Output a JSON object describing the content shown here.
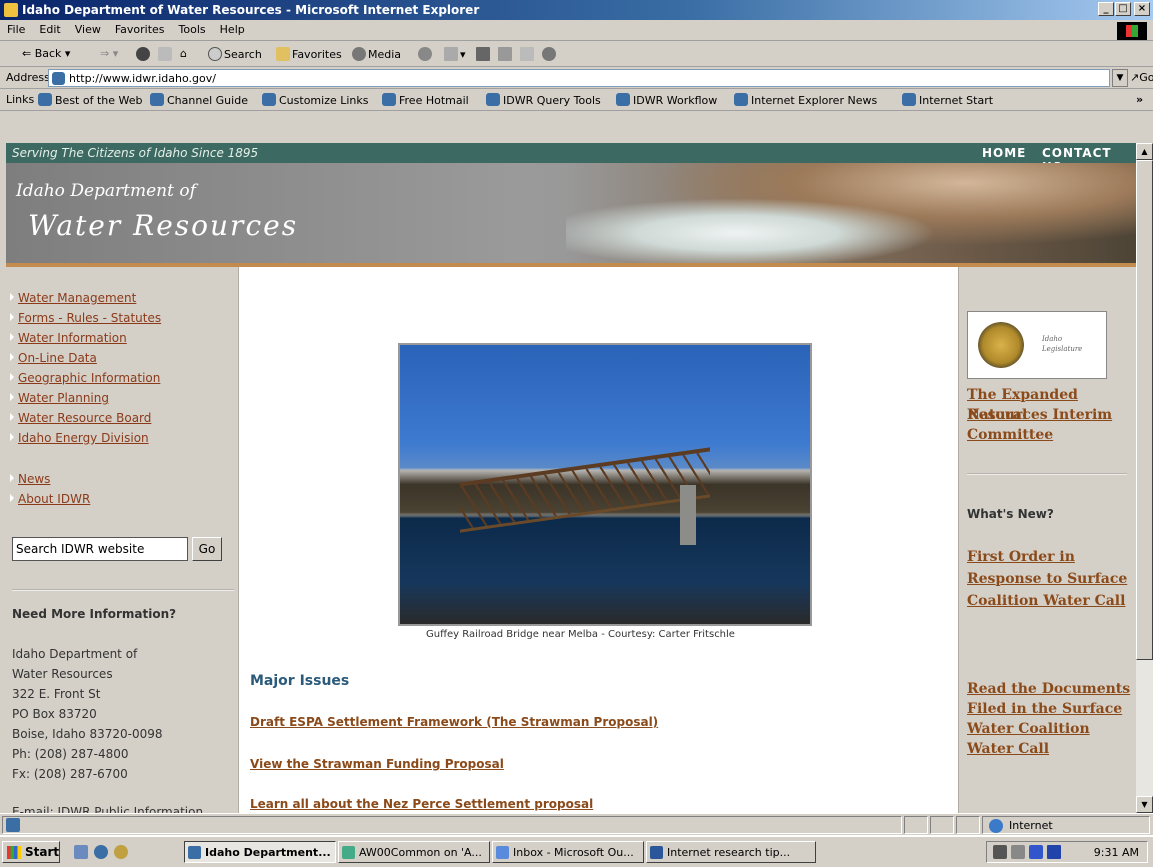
{
  "window": {
    "title": "Idaho Department of Water Resources - Microsoft Internet Explorer",
    "caption_buttons": [
      "_",
      "□",
      "×"
    ]
  },
  "menubar": {
    "items": [
      "File",
      "Edit",
      "View",
      "Favorites",
      "Tools",
      "Help"
    ]
  },
  "toolbar": {
    "back": "Back",
    "search": "Search",
    "favorites": "Favorites",
    "media": "Media"
  },
  "address": {
    "label": "Address",
    "url": "http://www.idwr.idaho.gov/",
    "go": "Go"
  },
  "links": {
    "label": "Links",
    "items": [
      "Best of the Web",
      "Channel Guide",
      "Customize Links",
      "Free Hotmail",
      "IDWR Query Tools",
      "IDWR Workflow",
      "Internet Explorer News",
      "Internet Start"
    ],
    "more": "»"
  },
  "site": {
    "tagline": "Serving The Citizens of Idaho Since 1895",
    "nav": [
      "HOME",
      "CONTACT US"
    ],
    "banner_line1": "Idaho Department of",
    "banner_line2": "Water Resources"
  },
  "left_nav": {
    "primary": [
      "Water Management",
      "Forms - Rules - Statutes",
      "Water Information",
      "On-Line Data",
      "Geographic Information",
      "Water Planning",
      "Water Resource Board",
      "Idaho Energy Division"
    ],
    "secondary": [
      "News",
      "About IDWR"
    ],
    "search_value": "Search IDWR website",
    "search_go": "Go",
    "need_more": "Need More Information?",
    "address_lines": [
      "Idaho Department of",
      "Water Resources",
      "322 E. Front St",
      "PO Box 83720",
      "Boise, Idaho 83720-0098",
      "Ph: (208) 287-4800",
      "Fx: (208) 287-6700"
    ],
    "email_partial": "E-mail: IDWR Public Information"
  },
  "main": {
    "photo_caption": "Guffey Railroad Bridge near Melba - Courtesy: Carter Fritschle",
    "major_issues": "Major Issues",
    "issues": [
      "Draft ESPA Settlement Framework (The Strawman Proposal)",
      "View the Strawman Funding Proposal",
      "Learn all about the Nez Perce Settlement proposal"
    ]
  },
  "right_col": {
    "legis_text": "Idaho\nLegislature",
    "committee_link": [
      "The Expanded Natural",
      "Resources Interim",
      "Committee"
    ],
    "whats_new": "What's New?",
    "news1": [
      "First Order in",
      "Response to Surface",
      "Coalition Water Call"
    ],
    "news2": [
      "Read the Documents",
      "Filed in the Surface",
      "Water Coalition",
      "Water Call"
    ]
  },
  "status": {
    "zone": "Internet"
  },
  "taskbar": {
    "start": "Start",
    "tasks": [
      "Idaho Department...",
      "AW00Common on 'A...",
      "Inbox - Microsoft Ou...",
      "Internet research tip..."
    ],
    "clock": "9:31 AM"
  },
  "colors": {
    "site_strip": "#3c6a62",
    "link": "#8b3a1a",
    "accent_line": "#c48b4e",
    "major_heading": "#2b5a7a"
  }
}
